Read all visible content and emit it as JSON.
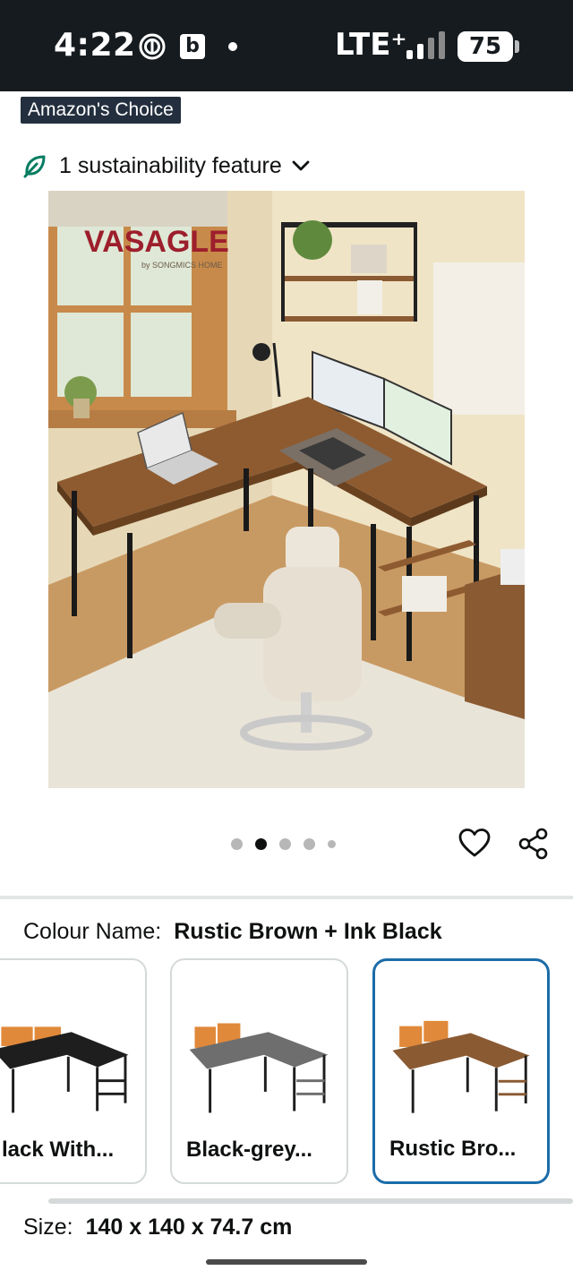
{
  "status_bar": {
    "time": "4:22",
    "b_label": "b",
    "network": "LTE⁺",
    "battery": "75"
  },
  "badge": {
    "label": "Amazon's Choice"
  },
  "sustainability": {
    "label": "1 sustainability feature"
  },
  "product_image": {
    "brand": "VASAGLE",
    "brand_sub": "by SONGMICS HOME"
  },
  "carousel": {
    "count": 5,
    "active_index": 1
  },
  "colour": {
    "label": "Colour Name:",
    "value": "Rustic Brown + Ink Black"
  },
  "swatches": [
    {
      "name": "lack With...",
      "top_color": "#1e1e1e",
      "selected": false
    },
    {
      "name": "Black-grey...",
      "top_color": "#6e6e6e",
      "selected": false
    },
    {
      "name": "Rustic Bro...",
      "top_color": "#8a5a33",
      "selected": true
    }
  ],
  "size": {
    "label": "Size:",
    "value": "140 x 140 x 74.7 cm"
  },
  "colors": {
    "status_bar_bg": "#161b1f",
    "badge_bg": "#232f3e",
    "selected_border": "#1b6ca8",
    "sustainability_green": "#067d62"
  }
}
